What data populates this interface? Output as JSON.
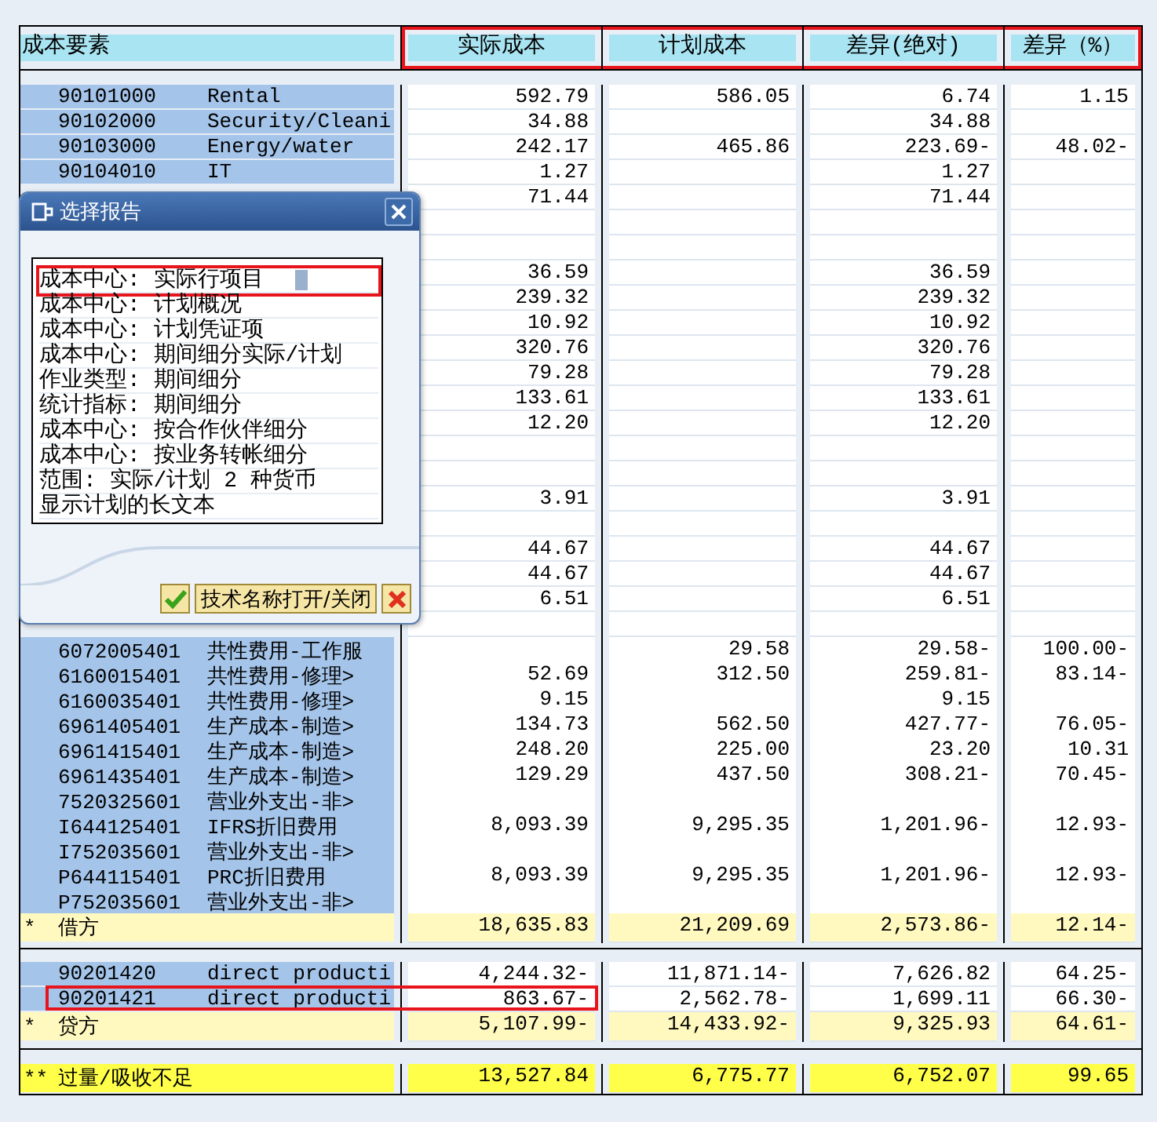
{
  "columns": [
    {
      "label": "成本要素",
      "highlighted": false
    },
    {
      "label": "实际成本",
      "highlighted": true
    },
    {
      "label": "计划成本",
      "highlighted": true
    },
    {
      "label": "差异(绝对)",
      "highlighted": true
    },
    {
      "label": "差异（%）",
      "highlighted": true
    }
  ],
  "sections": [
    {
      "rows": [
        {
          "kind": "detail",
          "code": "90101000",
          "description": "Rental",
          "actual": "592.79",
          "plan": "586.05",
          "variance": "6.74",
          "variance_pct": "1.15",
          "highlighted": false
        },
        {
          "kind": "detail",
          "code": "90102000",
          "description": "Security/Cleani",
          "actual": "34.88",
          "variance": "34.88",
          "highlighted": false
        },
        {
          "kind": "detail",
          "code": "90103000",
          "description": "Energy/water",
          "actual": "242.17",
          "plan": "465.86",
          "variance": "223.69-",
          "variance_pct": "48.02-",
          "highlighted": false
        },
        {
          "kind": "detail",
          "code": "90104010",
          "description": "IT",
          "actual": "1.27",
          "variance": "1.27",
          "highlighted": false
        },
        {
          "kind": "detail",
          "actual": "71.44",
          "variance": "71.44",
          "highlighted": false
        },
        {
          "kind": "detail",
          "highlighted": false
        },
        {
          "kind": "detail",
          "highlighted": false
        },
        {
          "kind": "detail",
          "actual": "36.59",
          "variance": "36.59",
          "highlighted": false
        },
        {
          "kind": "detail",
          "actual": "239.32",
          "variance": "239.32",
          "highlighted": false
        },
        {
          "kind": "detail",
          "actual": "10.92",
          "variance": "10.92",
          "highlighted": false
        },
        {
          "kind": "detail",
          "actual": "320.76",
          "variance": "320.76",
          "highlighted": false
        },
        {
          "kind": "detail",
          "actual": "79.28",
          "variance": "79.28",
          "highlighted": false
        },
        {
          "kind": "detail",
          "actual": "133.61",
          "variance": "133.61",
          "highlighted": false
        },
        {
          "kind": "detail",
          "actual": "12.20",
          "variance": "12.20",
          "highlighted": false
        },
        {
          "kind": "detail",
          "highlighted": false
        },
        {
          "kind": "detail",
          "highlighted": false
        },
        {
          "kind": "detail",
          "actual": "3.91",
          "variance": "3.91",
          "highlighted": false
        },
        {
          "kind": "detail",
          "highlighted": false
        },
        {
          "kind": "detail",
          "actual": "44.67",
          "variance": "44.67",
          "highlighted": false
        },
        {
          "kind": "detail",
          "actual": "44.67",
          "variance": "44.67",
          "highlighted": false
        },
        {
          "kind": "detail",
          "actual": "6.51",
          "variance": "6.51",
          "highlighted": false
        },
        {
          "kind": "detail",
          "highlighted": false
        },
        {
          "kind": "detail",
          "code": "6072005401",
          "description": "共性费用-工作服",
          "plan": "29.58",
          "variance": "29.58-",
          "variance_pct": "100.00-",
          "highlighted": false
        },
        {
          "kind": "detail",
          "code": "6160015401",
          "description": "共性费用-修理>",
          "actual": "52.69",
          "plan": "312.50",
          "variance": "259.81-",
          "variance_pct": "83.14-",
          "highlighted": false
        },
        {
          "kind": "detail",
          "code": "6160035401",
          "description": "共性费用-修理>",
          "actual": "9.15",
          "variance": "9.15",
          "highlighted": false
        },
        {
          "kind": "detail",
          "code": "6961405401",
          "description": "生产成本-制造>",
          "actual": "134.73",
          "plan": "562.50",
          "variance": "427.77-",
          "variance_pct": "76.05-",
          "highlighted": false
        },
        {
          "kind": "detail",
          "code": "6961415401",
          "description": "生产成本-制造>",
          "actual": "248.20",
          "plan": "225.00",
          "variance": "23.20",
          "variance_pct": "10.31",
          "highlighted": false
        },
        {
          "kind": "detail",
          "code": "6961435401",
          "description": "生产成本-制造>",
          "actual": "129.29",
          "plan": "437.50",
          "variance": "308.21-",
          "variance_pct": "70.45-",
          "highlighted": false
        },
        {
          "kind": "detail",
          "code": "7520325601",
          "description": "营业外支出-非>",
          "highlighted": false
        },
        {
          "kind": "detail",
          "code": "I644125401",
          "description": "IFRS折旧费用",
          "actual": "8,093.39",
          "plan": "9,295.35",
          "variance": "1,201.96-",
          "variance_pct": "12.93-",
          "highlighted": false
        },
        {
          "kind": "detail",
          "code": "I752035601",
          "description": "营业外支出-非>",
          "highlighted": false
        },
        {
          "kind": "detail",
          "code": "P644115401",
          "description": "PRC折旧费用",
          "actual": "8,093.39",
          "plan": "9,295.35",
          "variance": "1,201.96-",
          "variance_pct": "12.93-",
          "highlighted": false
        },
        {
          "kind": "detail",
          "code": "P752035601",
          "description": "营业外支出-非>",
          "highlighted": false
        },
        {
          "kind": "subtotal",
          "marker": "*",
          "description": "借方",
          "actual": "18,635.83",
          "plan": "21,209.69",
          "variance": "2,573.86-",
          "variance_pct": "12.14-",
          "highlighted": false
        }
      ]
    },
    {
      "rows": [
        {
          "kind": "detail",
          "code": "90201420",
          "description": "direct producti",
          "actual": "4,244.32-",
          "plan": "11,871.14-",
          "variance": "7,626.82",
          "variance_pct": "64.25-",
          "highlighted": false
        },
        {
          "kind": "detail",
          "code": "90201421",
          "description": "direct producti",
          "actual": "863.67-",
          "plan": "2,562.78-",
          "variance": "1,699.11",
          "variance_pct": "66.30-",
          "highlighted": true
        },
        {
          "kind": "subtotal",
          "marker": "*",
          "description": "贷方",
          "actual": "5,107.99-",
          "plan": "14,433.92-",
          "variance": "9,325.93",
          "variance_pct": "64.61-",
          "highlighted": false
        }
      ]
    },
    {
      "rows": [
        {
          "kind": "total",
          "marker": "**",
          "description": "过量/吸收不足",
          "actual": "13,527.84",
          "plan": "6,775.77",
          "variance": "6,752.07",
          "variance_pct": "99.65",
          "highlighted": false
        }
      ]
    }
  ],
  "dialog": {
    "title": "选择报告",
    "items": [
      {
        "label": "成本中心: 实际行项目",
        "selected": true,
        "highlighted": true
      },
      {
        "label": "成本中心: 计划概况",
        "selected": false,
        "highlighted": false
      },
      {
        "label": "成本中心: 计划凭证项",
        "selected": false,
        "highlighted": false
      },
      {
        "label": "成本中心: 期间细分实际/计划",
        "selected": false,
        "highlighted": false
      },
      {
        "label": "作业类型: 期间细分",
        "selected": false,
        "highlighted": false
      },
      {
        "label": "统计指标: 期间细分",
        "selected": false,
        "highlighted": false
      },
      {
        "label": "成本中心: 按合作伙伴细分",
        "selected": false,
        "highlighted": false
      },
      {
        "label": "成本中心: 按业务转帐细分",
        "selected": false,
        "highlighted": false
      },
      {
        "label": "范围: 实际/计划 2 种货币",
        "selected": false,
        "highlighted": false
      },
      {
        "label": "显示计划的长文本",
        "selected": false,
        "highlighted": false
      }
    ],
    "buttons": [
      {
        "kind": "confirm"
      },
      {
        "kind": "text",
        "label": "技术名称打开/关闭"
      },
      {
        "kind": "cancel"
      }
    ]
  }
}
